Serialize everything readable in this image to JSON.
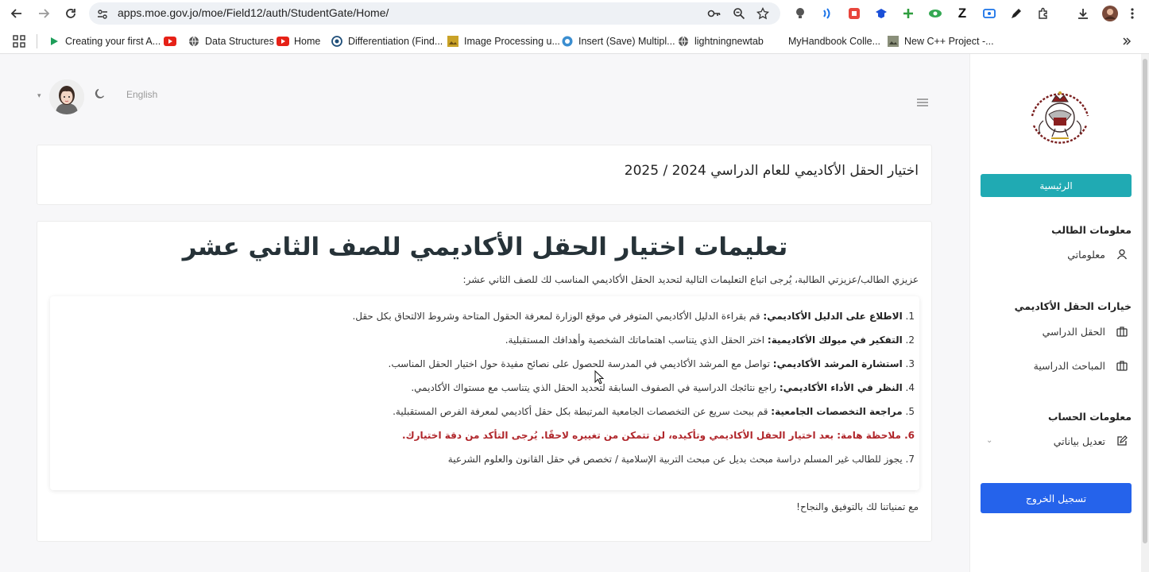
{
  "browser": {
    "url": "apps.moe.gov.jo/moe/Field12/auth/StudentGate/Home/",
    "bookmarks": [
      {
        "label": "Creating your first A...",
        "icon": "play-arrow-icon"
      },
      {
        "label": "",
        "icon": "youtube-icon"
      },
      {
        "label": "Data Structures",
        "icon": "globe-icon"
      },
      {
        "label": "Home",
        "icon": "youtube-icon"
      },
      {
        "label": "Differentiation (Find...",
        "icon": "circle-logo-icon"
      },
      {
        "label": "Image Processing u...",
        "icon": "bookmark-image-icon"
      },
      {
        "label": "Insert (Save) Multipl...",
        "icon": "app-icon"
      },
      {
        "label": "lightningnewtab",
        "icon": "globe-icon"
      },
      {
        "label": "MyHandbook Colle...",
        "icon": ""
      },
      {
        "label": "New C++ Project -...",
        "icon": "bookmark-image-icon"
      }
    ]
  },
  "colors": {
    "teal": "#20aab3",
    "blue": "#2563eb",
    "warning": "#b0262b",
    "heading": "#263238"
  },
  "header": {
    "language": "English"
  },
  "sidebar": {
    "home_label": "الرئيسية",
    "student_section": "معلومات الطالب",
    "my_info": "معلوماتي",
    "academic_section": "خيارات الحقل الأكاديمي",
    "field": "الحقل الدراسي",
    "subjects": "المباحث الدراسية",
    "account_section": "معلومات الحساب",
    "edit_data": "تعديل بياناتي",
    "logout_label": "تسجيل الخروج"
  },
  "main": {
    "card_title": "اختيار الحقل الأكاديمي للعام الدراسي 2024 / 2025",
    "heading": "تعليمات اختيار الحقل الأكاديمي للصف الثاني عشر",
    "intro": "عزيزي الطالب/عزيزتي الطالبة، يُرجى اتباع التعليمات التالية لتحديد الحقل الأكاديمي المناسب لك للصف الثاني عشر:",
    "steps": [
      {
        "num": "1.",
        "bold": "الاطلاع على الدليل الأكاديمي:",
        "text": " قم بقراءة الدليل الأكاديمي المتوفر في موقع الوزارة لمعرفة الحقول المتاحة وشروط الالتحاق بكل حقل."
      },
      {
        "num": "2.",
        "bold": "التفكير في ميولك الأكاديمية:",
        "text": " اختر الحقل الذي يتناسب اهتماماتك الشخصية وأهدافك المستقبلية."
      },
      {
        "num": "3.",
        "bold": "استشارة المرشد الأكاديمي:",
        "text": " تواصل مع المرشد الأكاديمي في المدرسة للحصول على نصائح مفيدة حول اختيار الحقل المناسب."
      },
      {
        "num": "4.",
        "bold": "النظر في الأداء الأكاديمي:",
        "text": " راجع نتائجك الدراسية في الصفوف السابقة لتحديد الحقل الذي يتناسب مع مستواك الأكاديمي."
      },
      {
        "num": "5.",
        "bold": "مراجعة التخصصات الجامعية:",
        "text": " قم ببحث سريع عن التخصصات الجامعية المرتبطة بكل حقل أكاديمي لمعرفة الفرص المستقبلية."
      },
      {
        "num": "6.",
        "bold": "ملاحظة هامة:",
        "text": " بعد اختيار الحقل الأكاديمي وتأكيده، لن تتمكن من تغييره لاحقًا. يُرجى التأكد من دقة اختيارك."
      },
      {
        "num": "7.",
        "bold": "",
        "text": "يجوز للطالب غير المسلم دراسة مبحث بديل عن مبحث التربية الإسلامية / تخصص في حقل القانون والعلوم الشرعية"
      }
    ],
    "closing": "مع تمنياتنا لك بالتوفيق والنجاح!"
  }
}
